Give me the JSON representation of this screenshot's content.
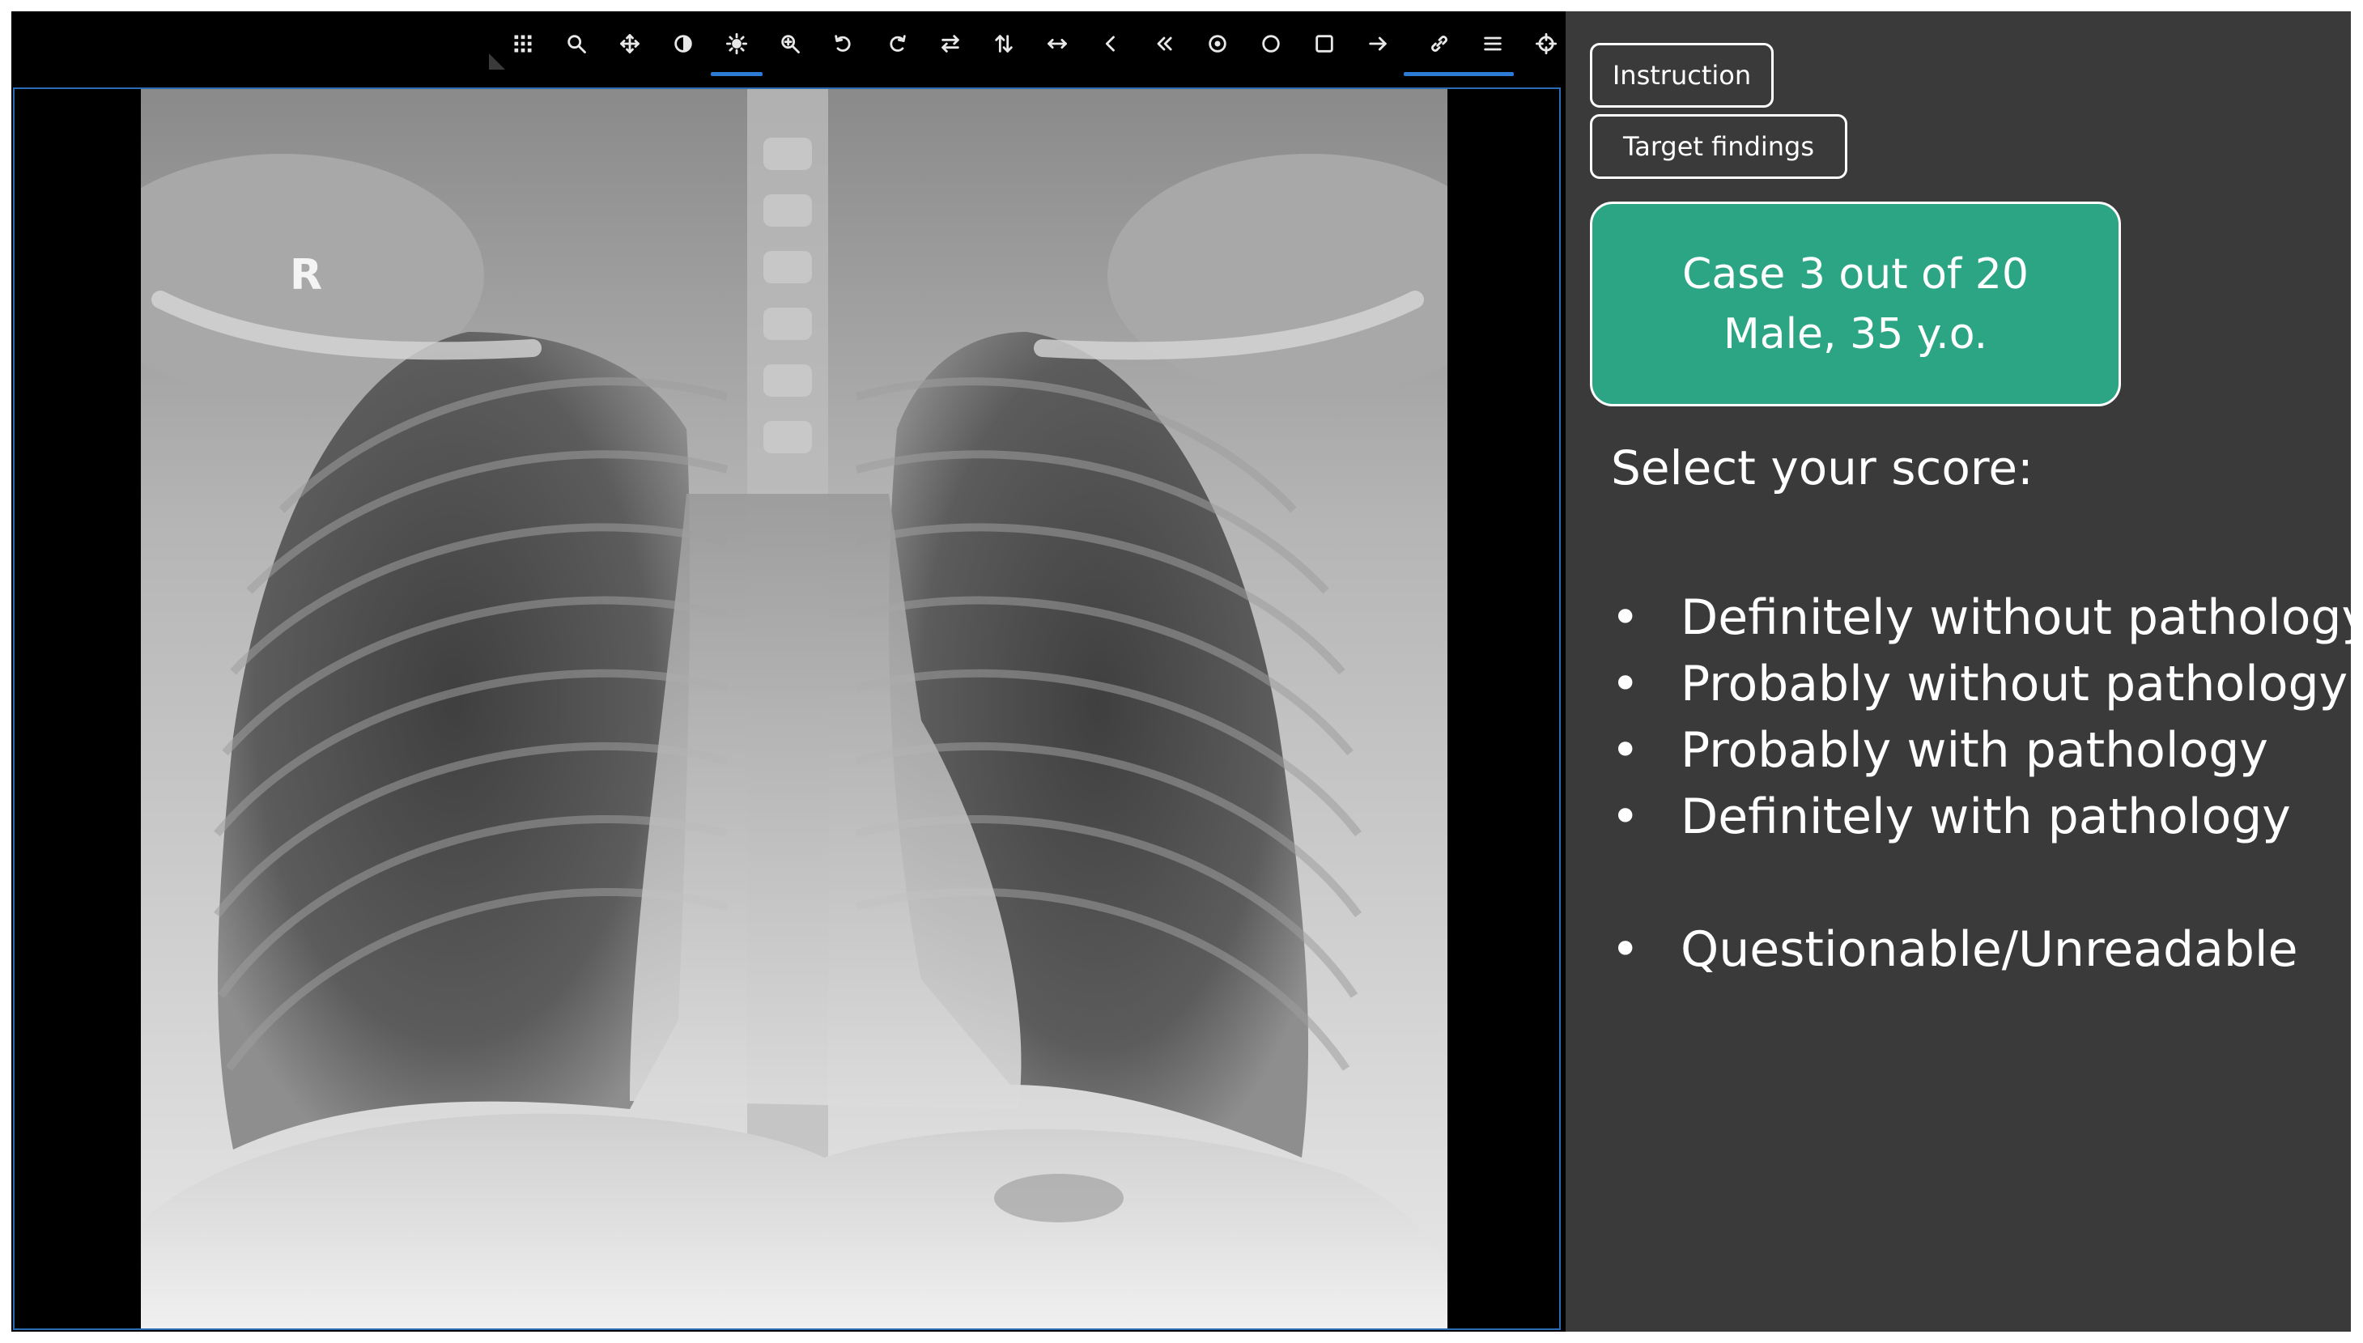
{
  "toolbar": {
    "tools": [
      {
        "icon": "grid-icon",
        "active": false
      },
      {
        "icon": "search-icon",
        "active": false
      },
      {
        "icon": "pan-icon",
        "active": false
      },
      {
        "icon": "contrast-icon",
        "active": false
      },
      {
        "icon": "brightness-icon",
        "active": true
      },
      {
        "icon": "zoom-in-icon",
        "active": false
      },
      {
        "icon": "rotate-left-icon",
        "active": false
      },
      {
        "icon": "rotate-right-icon",
        "active": false
      },
      {
        "icon": "flip-horizontal-icon",
        "active": false
      },
      {
        "icon": "flip-vertical-icon",
        "active": false
      },
      {
        "icon": "length-icon",
        "active": false
      },
      {
        "icon": "chevron-left-icon",
        "active": false
      },
      {
        "icon": "double-chevron-left-icon",
        "active": false
      },
      {
        "icon": "target-point-icon",
        "active": false
      },
      {
        "icon": "ellipse-icon",
        "active": false
      },
      {
        "icon": "rectangle-icon",
        "active": false
      },
      {
        "icon": "arrow-right-icon",
        "active": false
      },
      {
        "icon": "link-icon",
        "active": true
      },
      {
        "icon": "menu-icon",
        "active": false
      },
      {
        "icon": "crosshair-icon",
        "active": false
      }
    ],
    "accent_color": "#2e7bd6"
  },
  "viewer": {
    "orientation_marker": "R"
  },
  "panel": {
    "instruction_label": "Instruction",
    "target_findings_label": "Target findings",
    "case": {
      "line1": "Case 3 out of 20",
      "line2": "Male, 35 y.o.",
      "color": "#2ca584"
    },
    "score_heading": "Select your score:",
    "bullet": "•",
    "options": [
      "Definitely without pathology",
      "Probably without pathology",
      "Probably with pathology",
      "Definitely with pathology",
      "Questionable/Unreadable"
    ]
  }
}
